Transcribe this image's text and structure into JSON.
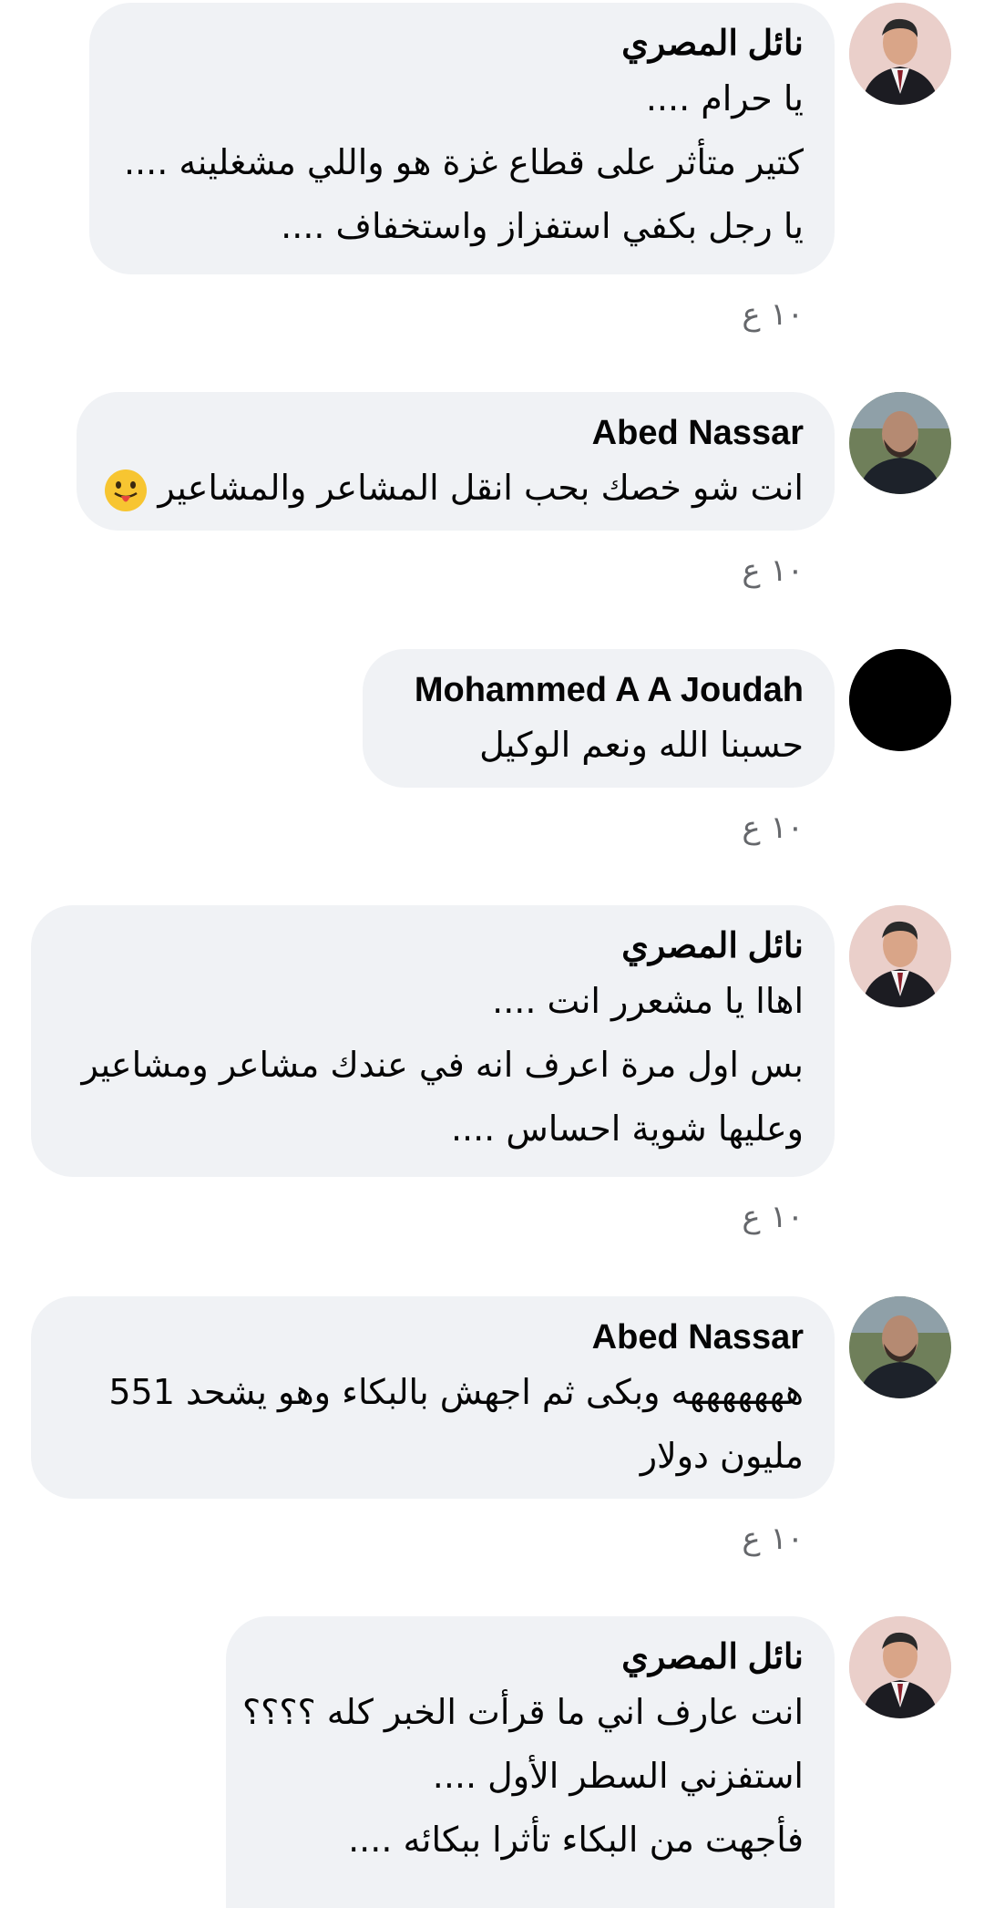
{
  "comments": [
    {
      "author": "نائل المصري",
      "avatar": "avatar-man-suit",
      "lines": [
        "يا حرام ....",
        "كتير متأثر على قطاع غزة هو واللي مشغلينه ....",
        "يا رجل بكفي استفزاز واستخفاف ...."
      ],
      "time": "١٠ ع"
    },
    {
      "author": "Abed Nassar",
      "avatar": "avatar-man-bald",
      "lines": [
        "انت شو خصك بحب انقل المشاعر والمشاعير"
      ],
      "emoji": "tongue-out-emoji",
      "time": "١٠ ع"
    },
    {
      "author": "Mohammed A A Joudah",
      "avatar": "avatar-black",
      "lines": [
        "حسبنا الله ونعم الوكيل"
      ],
      "time": "١٠ ع"
    },
    {
      "author": "نائل المصري",
      "avatar": "avatar-man-suit",
      "lines": [
        "اهاا يا مشعرر انت ....",
        "بس اول مرة اعرف انه في عندك مشاعر ومشاعير",
        "وعليها شوية احساس ...."
      ],
      "time": "١٠ ع"
    },
    {
      "author": "Abed Nassar",
      "avatar": "avatar-man-bald",
      "lines": [
        "هههههههه وبكى ثم اجهش بالبكاء وهو يشحد 551",
        "مليون دولار"
      ],
      "time": "١٠ ع"
    },
    {
      "author": "نائل المصري",
      "avatar": "avatar-man-suit",
      "lines": [
        "انت عارف اني ما قرأت الخبر كله ؟؟؟؟",
        "استفزني السطر الأول ....",
        "فأجهت من البكاء تأثرا ببكائه ...."
      ],
      "time": ""
    }
  ]
}
